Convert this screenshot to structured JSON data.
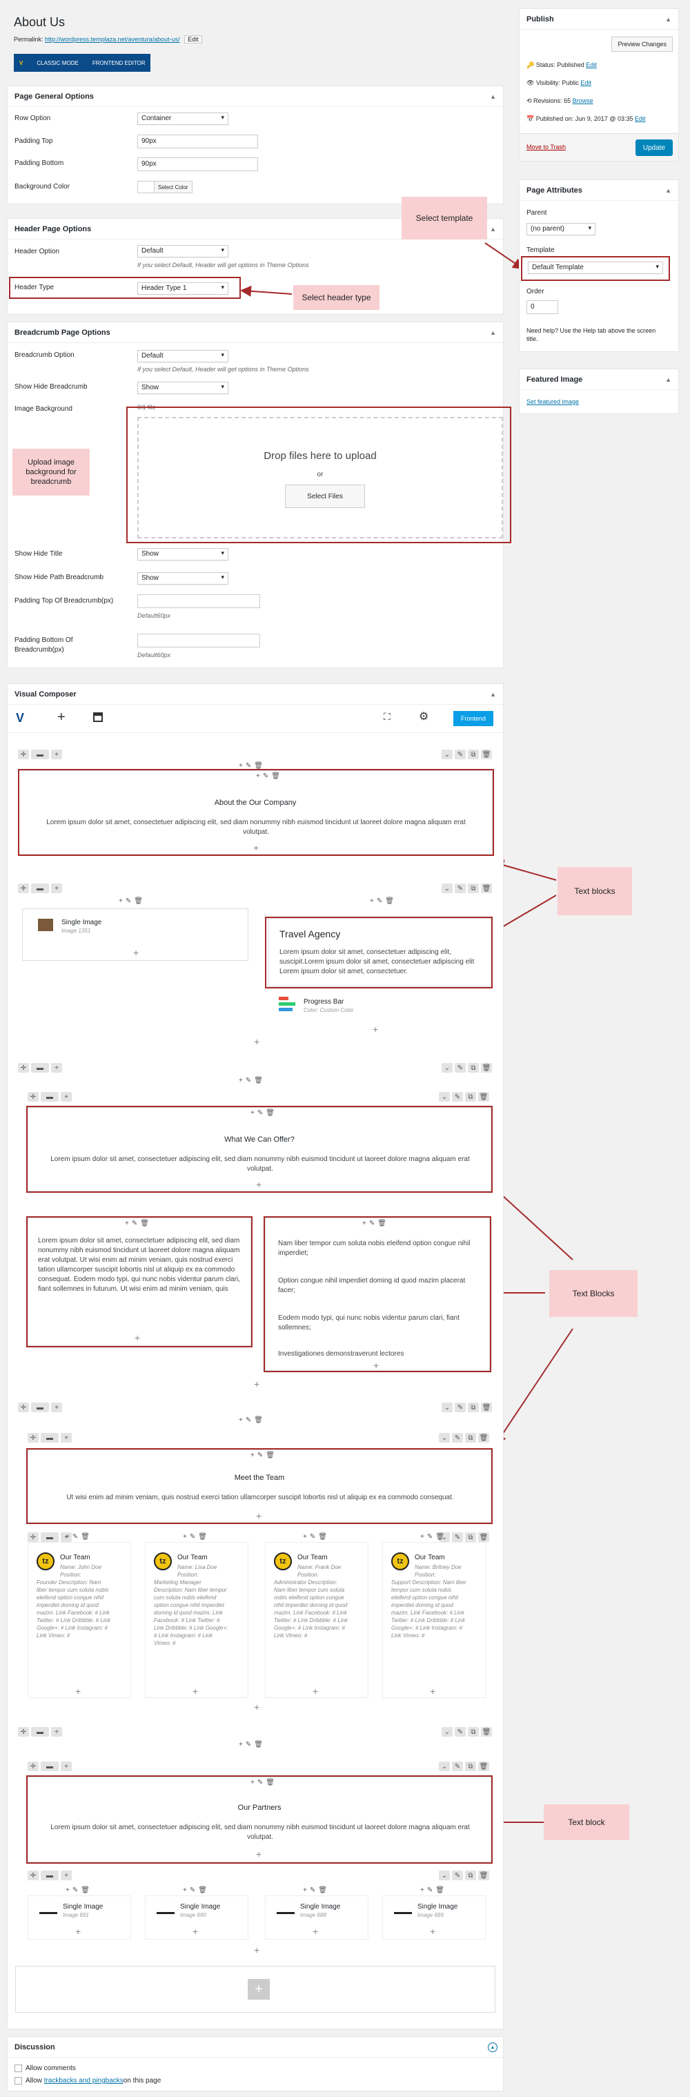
{
  "page": {
    "title": "About Us",
    "permalink_label": "Permalink:",
    "permalink_url": "http://wordpress.templaza.net/aventura/about-us/",
    "edit_btn": "Edit",
    "classic_mode": "CLASSIC MODE",
    "frontend_editor": "FRONTEND EDITOR"
  },
  "general": {
    "title": "Page General Options",
    "row_label": "Row Option",
    "row_value": "Container",
    "pt_label": "Padding Top",
    "pt_value": "90px",
    "pb_label": "Padding Bottom",
    "pb_value": "90px",
    "bg_label": "Background Color",
    "bg_btn": "Select Color"
  },
  "header": {
    "title": "Header Page Options",
    "opt_label": "Header Option",
    "opt_value": "Default",
    "hint": "If you select Default, Header will get options in Theme Options",
    "type_label": "Header Type",
    "type_value": "Header Type 1"
  },
  "breadcrumb": {
    "title": "Breadcrumb Page Options",
    "opt_label": "Breadcrumb Option",
    "opt_value": "Default",
    "hint": "If you select Default, Header will get options in Theme Options",
    "shb_label": "Show Hide Breadcrumb",
    "shb_value": "Show",
    "img_label": "Image Background",
    "file_count": "0/1 file",
    "drop": "Drop files here to upload",
    "or": "or",
    "select_files": "Select Files",
    "sht_label": "Show Hide Title",
    "sht_value": "Show",
    "shp_label": "Show Hide Path Breadcrumb",
    "shp_value": "Show",
    "ptop_label": "Padding Top Of Breadcrumb(px)",
    "ptop_hint": "Default60px",
    "pbot_label": "Padding Bottom Of Breadcrumb(px)",
    "pbot_hint": "Default60px"
  },
  "vc": {
    "title": "Visual Composer",
    "frontend": "Frontend",
    "about_title": "About the Our Company",
    "about_text": "Lorem ipsum dolor sit amet, consectetuer adipiscing elit, sed diam nonummy nibh euismod tincidunt ut laoreet dolore magna aliquam erat volutpat.",
    "single_image": "Single Image",
    "image_1": "Image 1351",
    "travel_title": "Travel Agency",
    "travel_text": "Lorem ipsum dolor sit amet, consectetuer adipiscing elit, suscipit.Lorem ipsum dolor sit amet, consectetuer adipiscing elit Lorem ipsum dolor sit amet, consectetuer.",
    "progress": "Progress Bar",
    "progress_sub": "Color: Custom Color",
    "offer_title": "What We Can Offer?",
    "offer_text": "Lorem ipsum dolor sit amet, consectetuer adipiscing elit, sed diam nonummy nibh euismod tincidunt ut laoreet dolore magna aliquam erat volutpat.",
    "left_text": "Lorem ipsum dolor sit amet, consectetuer adipiscing elit, sed diam nonummy nibh euismod tincidunt ut laoreet dolore magna aliquam erat volutpat. Ut wisi enim ad minim veniam, quis nostrud exerci tation ullamcorper suscipit lobortis nisl ut aliquip ex ea commodo consequat. Eodem modo typi, qui nunc nobis videntur parum clari, fiant sollemnes in futurum. Ut wisi enim ad minim veniam, quis",
    "right_p1": "Nam liber tempor cum soluta nobis eleifend option congue nihil imperdiet;",
    "right_p2": "Option congue nihil imperdiet doming id quod mazim placerat facer;",
    "right_p3": "Eodem modo typi, qui nunc nobis videntur parum clari, fiant sollemnes;",
    "right_p4": "Investigationes demonstraverunt lectores",
    "team_title": "Meet the Team",
    "team_text": "Ut wisi enim ad minim veniam, quis nostrud exerci tation ullamcorper suscipit lobortis nisl ut aliquip ex ea commodo consequat.",
    "members": [
      {
        "name": "Our Team",
        "sub": "Name: John Doe Position:",
        "desc": "Founder Description: Nam liber tempor cum soluta nobis eleifend option congue nihil imperdiet doming id quod mazim. Link Facebook: # Link Twitter: # Link Dribbble: # Link Google+: # Link Instagram: # Link Vimeo: #"
      },
      {
        "name": "Our Team",
        "sub": "Name: Lisa Doe Position:",
        "desc": "Marketing Manager Description: Nam liber tempor cum soluta nobis eleifend option congue nihil imperdiet doming id quod mazim. Link Facebook: # Link Twitter: # Link Dribbble: # Link Google+: # Link Instagram: # Link Vimeo: #"
      },
      {
        "name": "Our Team",
        "sub": "Name: Frank Doe Position:",
        "desc": "Administrator Description: Nam liber tempor cum soluta nobis eleifend option congue nihil imperdiet doming id quod mazim. Link Facebook: # Link Twitter: # Link Dribbble: # Link Google+: # Link Instagram: # Link Vimeo: #"
      },
      {
        "name": "Our Team",
        "sub": "Name: Britney Doe Position:",
        "desc": "Support Description: Nam liber tempor cum soluta nobis eleifend option congue nihil imperdiet doming id quod mazim. Link Facebook: # Link Twitter: # Link Dribbble: # Link Google+: # Link Instagram: # Link Vimeo: #"
      }
    ],
    "partners_title": "Our Partners",
    "partners_text": "Lorem ipsum dolor sit amet, consectetuer adipiscing elit, sed diam nonummy nibh euismod tincidunt ut laoreet dolore magna aliquam erat volutpat.",
    "partners": [
      {
        "label": "Single Image",
        "sub": "Image 691"
      },
      {
        "label": "Single Image",
        "sub": "Image 690"
      },
      {
        "label": "Single Image",
        "sub": "Image 688"
      },
      {
        "label": "Single Image",
        "sub": "Image 689"
      }
    ]
  },
  "callouts": {
    "template": "Select template",
    "header_type": "Select header type",
    "upload": "Upload image background for breadcrumb",
    "text_blocks": "Text blocks",
    "text_blocks2": "Text Blocks",
    "text_block": "Text block"
  },
  "discussion": {
    "title": "Discussion",
    "allow_comments": "Allow comments",
    "allow_pre": "Allow ",
    "trackbacks": "trackbacks and pingbacks",
    "allow_post": " on this page"
  },
  "publish": {
    "title": "Publish",
    "preview": "Preview Changes",
    "status_label": "Status: ",
    "status": "Published",
    "visibility_label": "Visibility: ",
    "visibility": "Public",
    "revisions_label": "Revisions: ",
    "revisions": "65",
    "browse": "Browse",
    "published_label": "Published on: ",
    "published": "Jun 9, 2017 @ 03:35",
    "edit": "Edit",
    "trash": "Move to Trash",
    "update": "Update"
  },
  "attributes": {
    "title": "Page Attributes",
    "parent_label": "Parent",
    "parent_value": "(no parent)",
    "template_label": "Template",
    "template_value": "Default Template",
    "order_label": "Order",
    "order_value": "0",
    "help": "Need help? Use the Help tab above the screen title."
  },
  "featured": {
    "title": "Featured Image",
    "set": "Set featured image"
  }
}
